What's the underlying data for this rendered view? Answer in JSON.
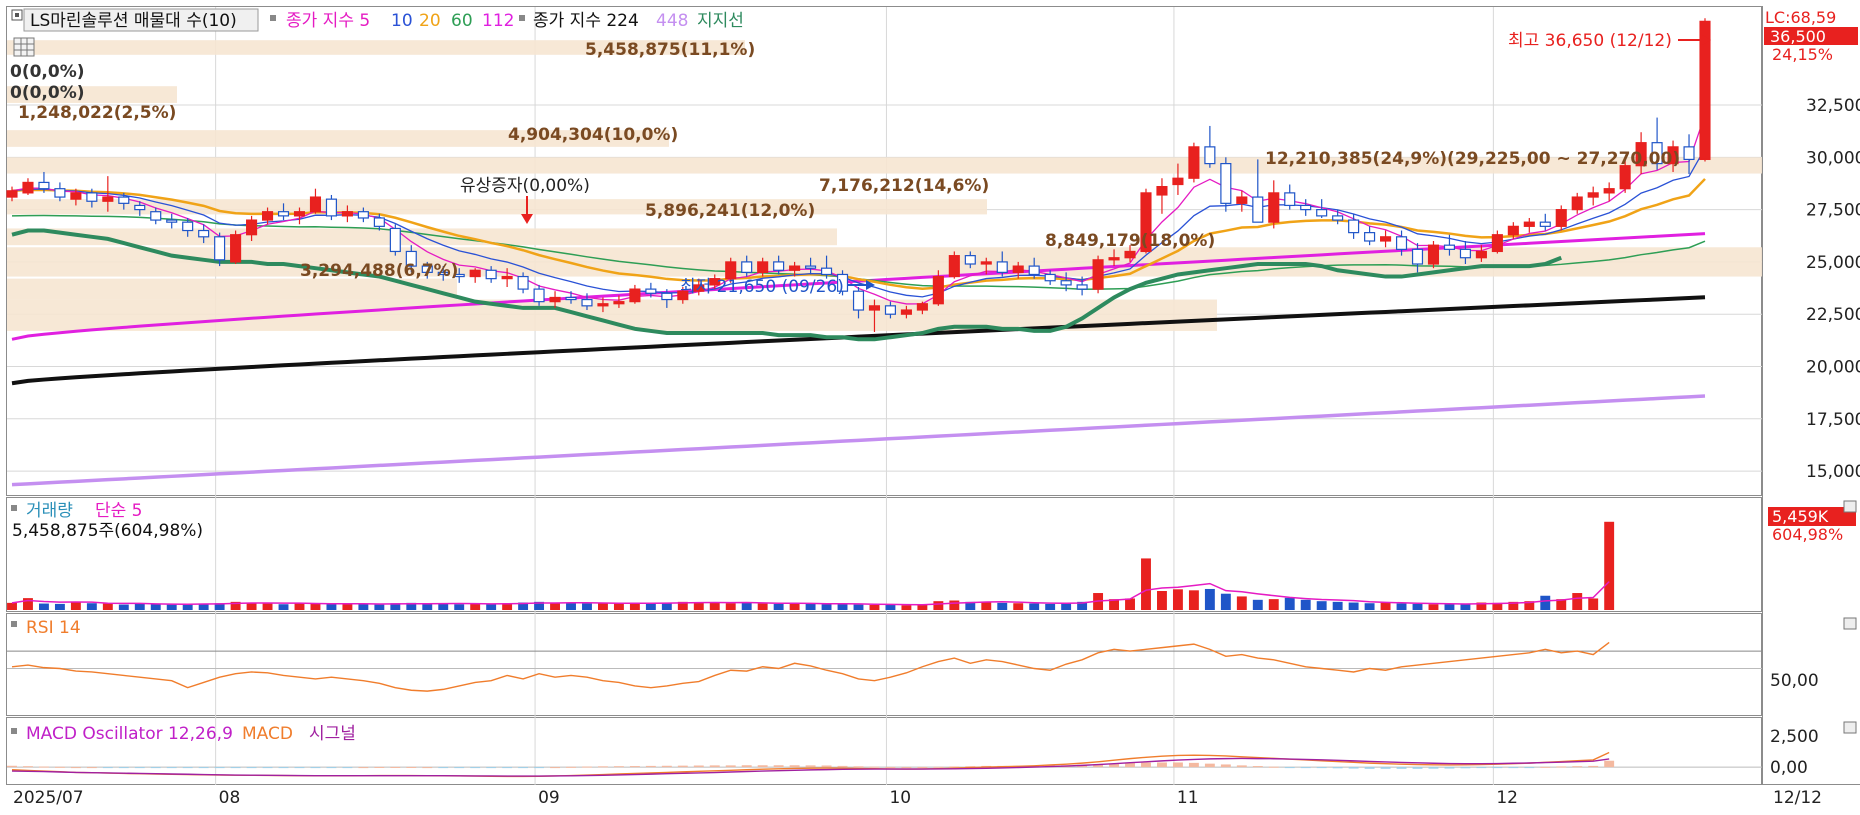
{
  "top_bar": {
    "volume_profile_label": "LS마린솔루션 매물대 수(10)",
    "ma_label": "종가 지수 5",
    "ma_values": [
      "10",
      "20",
      "60",
      "112"
    ],
    "ma_long_label": "종가 지수 224",
    "ma_long_values": [
      "448"
    ],
    "support_label": "지지선"
  },
  "right_labels": {
    "lc": "LC:68,59",
    "current_price": "36,500",
    "change_pct": "24,15%",
    "volume_now": "5,459K",
    "volume_pct": "604,98%"
  },
  "volume_profile_bars": [
    {
      "label": "5,458,875(11,1%)"
    },
    {
      "label": "0(0,0%)"
    },
    {
      "label": "0(0,0%)"
    },
    {
      "label": "1,248,022(2,5%)"
    },
    {
      "label": "4,904,304(10,0%)"
    },
    {
      "label": "7,176,212(14,6%)"
    },
    {
      "label": "5,896,241(12,0%)"
    },
    {
      "label": "3,294,488(6,7%)"
    },
    {
      "label": "8,849,179(18,0%)"
    },
    {
      "label": "12,210,385(24,9%)(29,225,00 ~ 27,270,00)"
    }
  ],
  "annotations": {
    "high": "최고 36,650 (12/12)",
    "low": "최저 21,650 (09/26)",
    "rights_issue": "유상증자(0,00%)"
  },
  "volume_panel": {
    "title": "거래량",
    "ma_label": "단순 5",
    "readout": "5,458,875주(604,98%)"
  },
  "rsi_panel": {
    "title": "RSI 14",
    "level_label": "50,00"
  },
  "macd_panel": {
    "title": "MACD Oscillator 12,26,9",
    "macd_label": "MACD",
    "signal_label": "시그널",
    "tick_top": "2,500",
    "tick_zero": "0,00"
  },
  "colors": {
    "up": "#e8211f",
    "down": "#1f55c8",
    "ma5": "#e51bc3",
    "ma10": "#2a52d6",
    "ma20": "#f0a317",
    "ma60": "#2e9e55",
    "ma112": "#e020e0",
    "ma224": "#111111",
    "ma448": "#c48ff0",
    "support": "#2e8a5e",
    "profile": "#f6e5d2",
    "rsi": "#f07d2c",
    "macd": "#f07d2c",
    "signal": "#a020a0"
  },
  "chart_data": {
    "type": "candlestick",
    "title": "LS마린솔루션",
    "price_axis_ticks": [
      "15,000",
      "17,500",
      "20,000",
      "22,500",
      "25,000",
      "27,500",
      "30,000",
      "32,500"
    ],
    "price_axis_values": [
      15000,
      17500,
      20000,
      22500,
      25000,
      27500,
      30000,
      32500
    ],
    "ylim": [
      14000,
      35800
    ],
    "x_ticks": [
      "2025/07",
      "08",
      "09",
      "10",
      "11",
      "12",
      "12/12"
    ],
    "x_tick_index": [
      0,
      13,
      33,
      55,
      73,
      93,
      104
    ],
    "ohlc": [
      [
        28100,
        28600,
        27900,
        28400
      ],
      [
        28300,
        29000,
        28200,
        28800
      ],
      [
        28800,
        29300,
        28300,
        28500
      ],
      [
        28500,
        28800,
        27900,
        28100
      ],
      [
        28000,
        28500,
        27700,
        28300
      ],
      [
        28300,
        28500,
        27600,
        27900
      ],
      [
        27900,
        29100,
        27400,
        28100
      ],
      [
        28100,
        28300,
        27500,
        27800
      ],
      [
        27700,
        27900,
        27200,
        27500
      ],
      [
        27400,
        27600,
        26800,
        27000
      ],
      [
        27000,
        27300,
        26600,
        26900
      ],
      [
        26900,
        27100,
        26200,
        26500
      ],
      [
        26500,
        26800,
        25900,
        26200
      ],
      [
        26200,
        26400,
        24800,
        25100
      ],
      [
        25000,
        26500,
        24900,
        26300
      ],
      [
        26300,
        27200,
        26000,
        27000
      ],
      [
        27000,
        27600,
        26800,
        27400
      ],
      [
        27400,
        27800,
        27000,
        27200
      ],
      [
        27200,
        27600,
        26800,
        27400
      ],
      [
        27400,
        28500,
        27300,
        28100
      ],
      [
        28000,
        28200,
        27000,
        27200
      ],
      [
        27200,
        27700,
        26900,
        27400
      ],
      [
        27400,
        27600,
        26900,
        27100
      ],
      [
        27100,
        27300,
        26500,
        26700
      ],
      [
        26600,
        26800,
        25300,
        25500
      ],
      [
        25500,
        25800,
        24500,
        24800
      ],
      [
        24800,
        25000,
        24200,
        24500
      ],
      [
        24500,
        24800,
        24100,
        24400
      ],
      [
        24400,
        24700,
        24000,
        24300
      ],
      [
        24300,
        24700,
        24000,
        24600
      ],
      [
        24600,
        24800,
        24000,
        24200
      ],
      [
        24200,
        24700,
        23800,
        24300
      ],
      [
        24300,
        24500,
        23500,
        23700
      ],
      [
        23700,
        23900,
        22900,
        23100
      ],
      [
        23100,
        23600,
        22800,
        23300
      ],
      [
        23300,
        23600,
        23000,
        23200
      ],
      [
        23200,
        23500,
        22700,
        22900
      ],
      [
        22900,
        23300,
        22600,
        23000
      ],
      [
        23000,
        23400,
        22800,
        23100
      ],
      [
        23100,
        23900,
        23000,
        23700
      ],
      [
        23700,
        24000,
        23300,
        23500
      ],
      [
        23500,
        23700,
        22800,
        23200
      ],
      [
        23200,
        23800,
        23000,
        23600
      ],
      [
        23600,
        24200,
        23400,
        23900
      ],
      [
        23900,
        24400,
        23700,
        24200
      ],
      [
        24200,
        25200,
        24000,
        25000
      ],
      [
        25000,
        25300,
        24300,
        24500
      ],
      [
        24500,
        25200,
        24300,
        25000
      ],
      [
        25000,
        25300,
        24400,
        24600
      ],
      [
        24600,
        25000,
        24300,
        24800
      ],
      [
        24800,
        25200,
        24400,
        24700
      ],
      [
        24700,
        25300,
        24200,
        24400
      ],
      [
        24400,
        24600,
        23400,
        23600
      ],
      [
        23600,
        23800,
        22300,
        22700
      ],
      [
        22700,
        23200,
        21650,
        22900
      ],
      [
        22900,
        23100,
        22300,
        22500
      ],
      [
        22500,
        22900,
        22300,
        22700
      ],
      [
        22700,
        23100,
        22500,
        23000
      ],
      [
        23000,
        24600,
        22900,
        24300
      ],
      [
        24300,
        25500,
        24200,
        25300
      ],
      [
        25300,
        25500,
        24700,
        24900
      ],
      [
        24900,
        25200,
        24400,
        25000
      ],
      [
        25000,
        25500,
        24300,
        24500
      ],
      [
        24500,
        25000,
        24200,
        24800
      ],
      [
        24800,
        25200,
        24200,
        24400
      ],
      [
        24400,
        24600,
        23900,
        24100
      ],
      [
        24100,
        24500,
        23600,
        23900
      ],
      [
        23900,
        24300,
        23400,
        23700
      ],
      [
        23700,
        25300,
        23500,
        25100
      ],
      [
        25100,
        25600,
        24800,
        25200
      ],
      [
        25200,
        25800,
        25000,
        25500
      ],
      [
        25500,
        28500,
        25400,
        28300
      ],
      [
        28200,
        29000,
        27300,
        28600
      ],
      [
        28700,
        29700,
        28200,
        29000
      ],
      [
        29000,
        30700,
        28800,
        30500
      ],
      [
        30500,
        31500,
        29500,
        29700
      ],
      [
        29700,
        30000,
        27400,
        27800
      ],
      [
        27800,
        28400,
        27400,
        28100
      ],
      [
        28100,
        29900,
        27700,
        26900
      ],
      [
        26900,
        28900,
        26600,
        28300
      ],
      [
        28300,
        28700,
        27500,
        27700
      ],
      [
        27700,
        28000,
        27200,
        27500
      ],
      [
        27500,
        28000,
        27100,
        27200
      ],
      [
        27200,
        27500,
        26800,
        27000
      ],
      [
        27000,
        27300,
        26100,
        26400
      ],
      [
        26400,
        26700,
        25800,
        26000
      ],
      [
        26000,
        26500,
        25700,
        26200
      ],
      [
        26200,
        26500,
        25300,
        25600
      ],
      [
        25600,
        25900,
        24500,
        24900
      ],
      [
        24900,
        26000,
        24700,
        25800
      ],
      [
        25800,
        26300,
        25300,
        25600
      ],
      [
        25600,
        26000,
        24900,
        25200
      ],
      [
        25200,
        25800,
        25000,
        25500
      ],
      [
        25500,
        26500,
        25400,
        26300
      ],
      [
        26300,
        26900,
        26100,
        26700
      ],
      [
        26700,
        27100,
        26400,
        26900
      ],
      [
        26900,
        27300,
        26500,
        26700
      ],
      [
        26700,
        27700,
        26500,
        27500
      ],
      [
        27500,
        28300,
        27300,
        28100
      ],
      [
        28100,
        28600,
        27700,
        28300
      ],
      [
        28300,
        28800,
        27900,
        28500
      ],
      [
        28500,
        29900,
        28300,
        29600
      ],
      [
        29600,
        31200,
        29200,
        30700
      ],
      [
        30700,
        31900,
        29400,
        29700
      ],
      [
        29700,
        30800,
        29300,
        30500
      ],
      [
        30500,
        31100,
        29200,
        29900
      ],
      [
        29900,
        36650,
        29800,
        36500
      ]
    ],
    "volume": [
      105,
      175,
      95,
      90,
      120,
      100,
      95,
      80,
      90,
      85,
      80,
      90,
      95,
      100,
      120,
      110,
      95,
      85,
      100,
      90,
      95,
      90,
      85,
      80,
      100,
      105,
      95,
      90,
      85,
      95,
      90,
      100,
      110,
      120,
      100,
      105,
      95,
      100,
      95,
      100,
      110,
      100,
      120,
      115,
      105,
      100,
      110,
      95,
      90,
      100,
      95,
      85,
      90,
      80,
      75,
      80,
      70,
      85,
      130,
      140,
      120,
      115,
      105,
      100,
      95,
      90,
      110,
      120,
      250,
      160,
      170,
      760,
      280,
      305,
      290,
      310,
      240,
      200,
      150,
      160,
      180,
      150,
      130,
      120,
      110,
      100,
      105,
      95,
      90,
      85,
      85,
      90,
      110,
      105,
      120,
      130,
      210,
      160,
      250,
      170,
      1300
    ],
    "volume_max": 1400,
    "support_line": [
      26300,
      26500,
      26500,
      26400,
      26300,
      26200,
      26100,
      25900,
      25700,
      25500,
      25300,
      25200,
      25100,
      25000,
      25000,
      25000,
      24900,
      24900,
      24800,
      24700,
      24600,
      24500,
      24400,
      24300,
      24100,
      23900,
      23700,
      23500,
      23300,
      23100,
      23000,
      22900,
      22800,
      22800,
      22800,
      22600,
      22400,
      22200,
      22000,
      21800,
      21700,
      21600,
      21600,
      21600,
      21600,
      21600,
      21600,
      21600,
      21500,
      21500,
      21500,
      21400,
      21400,
      21300,
      21300,
      21400,
      21500,
      21600,
      21800,
      21900,
      21900,
      21900,
      21800,
      21800,
      21700,
      21700,
      21900,
      22300,
      22800,
      23300,
      23700,
      24000,
      24200,
      24400,
      24500,
      24600,
      24700,
      24800,
      24900,
      24900,
      24900,
      24900,
      24800,
      24600,
      24500,
      24400,
      24300,
      24300,
      24400,
      24500,
      24600,
      24700,
      24800,
      24800,
      24800,
      24800,
      24900,
      25200
    ],
    "rsi_range": [
      0,
      100
    ],
    "rsi_level": 50,
    "rsi": [
      52,
      54,
      51,
      50,
      47,
      46,
      44,
      42,
      40,
      38,
      36,
      28,
      34,
      40,
      44,
      46,
      45,
      42,
      40,
      38,
      40,
      38,
      36,
      33,
      28,
      25,
      24,
      26,
      30,
      34,
      36,
      42,
      38,
      44,
      40,
      42,
      40,
      36,
      34,
      30,
      28,
      30,
      33,
      35,
      42,
      48,
      47,
      52,
      50,
      56,
      53,
      48,
      44,
      38,
      36,
      40,
      45,
      52,
      58,
      62,
      56,
      60,
      58,
      54,
      50,
      48,
      55,
      60,
      68,
      72,
      70,
      72,
      74,
      76,
      78,
      72,
      64,
      66,
      62,
      60,
      56,
      52,
      50,
      48,
      46,
      50,
      48,
      52,
      54,
      56,
      58,
      60,
      62,
      64,
      66,
      68,
      72,
      68,
      70,
      66,
      80
    ],
    "macd_range": [
      -1200,
      2800
    ],
    "macd": [
      -200,
      -250,
      -300,
      -350,
      -400,
      -420,
      -450,
      -480,
      -500,
      -520,
      -540,
      -560,
      -580,
      -600,
      -610,
      -620,
      -630,
      -640,
      -650,
      -660,
      -660,
      -660,
      -650,
      -640,
      -640,
      -640,
      -650,
      -660,
      -670,
      -680,
      -690,
      -700,
      -700,
      -690,
      -670,
      -640,
      -600,
      -560,
      -520,
      -480,
      -440,
      -400,
      -360,
      -320,
      -280,
      -240,
      -200,
      -160,
      -130,
      -100,
      -80,
      -70,
      -80,
      -100,
      -120,
      -140,
      -150,
      -140,
      -120,
      -80,
      -40,
      0,
      30,
      60,
      100,
      160,
      220,
      300,
      400,
      520,
      640,
      740,
      820,
      880,
      900,
      880,
      840,
      780,
      720,
      660,
      600,
      540,
      480,
      420,
      360,
      300,
      260,
      220,
      190,
      170,
      160,
      170,
      190,
      220,
      260,
      300,
      360,
      420,
      480,
      540,
      1100
    ],
    "signal": [
      -300,
      -320,
      -340,
      -370,
      -400,
      -420,
      -440,
      -460,
      -480,
      -500,
      -520,
      -540,
      -560,
      -580,
      -600,
      -610,
      -620,
      -630,
      -640,
      -650,
      -650,
      -650,
      -650,
      -650,
      -650,
      -650,
      -650,
      -650,
      -660,
      -670,
      -670,
      -680,
      -680,
      -680,
      -670,
      -660,
      -640,
      -620,
      -590,
      -560,
      -530,
      -500,
      -470,
      -440,
      -410,
      -370,
      -340,
      -300,
      -270,
      -240,
      -210,
      -190,
      -170,
      -160,
      -150,
      -150,
      -150,
      -150,
      -140,
      -130,
      -110,
      -90,
      -60,
      -30,
      0,
      40,
      80,
      130,
      190,
      260,
      330,
      400,
      470,
      530,
      580,
      620,
      640,
      650,
      640,
      630,
      610,
      580,
      550,
      510,
      470,
      430,
      390,
      350,
      320,
      290,
      270,
      260,
      260,
      270,
      290,
      310,
      340,
      370,
      410,
      450,
      620
    ]
  }
}
